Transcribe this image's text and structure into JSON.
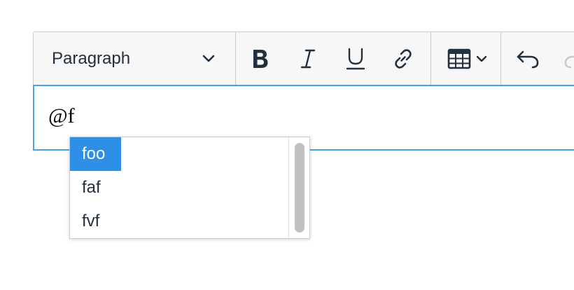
{
  "toolbar": {
    "format_select": {
      "value": "Paragraph",
      "icon": "chevron-down-icon"
    },
    "buttons": [
      {
        "name": "bold-button",
        "icon": "bold-icon"
      },
      {
        "name": "italic-button",
        "icon": "italic-icon"
      },
      {
        "name": "underline-button",
        "icon": "underline-icon"
      },
      {
        "name": "link-button",
        "icon": "link-icon"
      },
      {
        "name": "table-button",
        "icon": "table-icon"
      },
      {
        "name": "undo-button",
        "icon": "undo-icon"
      },
      {
        "name": "redo-button",
        "icon": "redo-icon"
      }
    ]
  },
  "editor": {
    "content_text": "@f"
  },
  "autocomplete": {
    "items": [
      {
        "label": "foo",
        "selected": true
      },
      {
        "label": "faf",
        "selected": false
      },
      {
        "label": "fvf",
        "selected": false
      }
    ]
  },
  "colors": {
    "accent": "#2e8fe6",
    "focus_border": "#4aa3e6",
    "toolbar_bg": "#f7f7f7",
    "icon": "#222f3e"
  }
}
